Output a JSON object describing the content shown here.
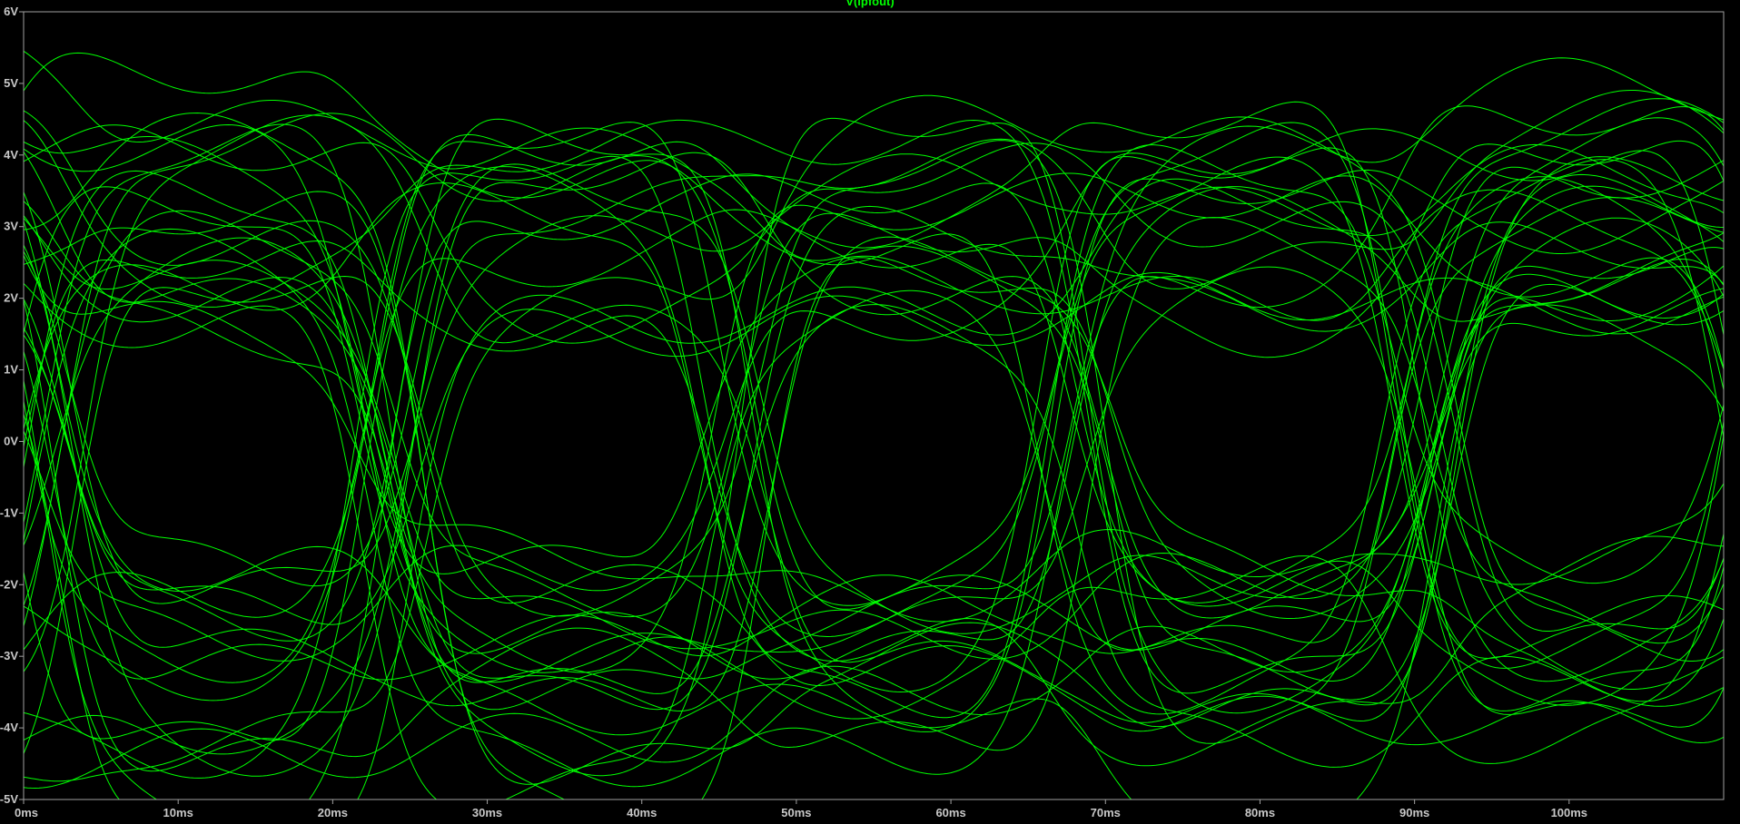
{
  "chart_data": {
    "type": "line",
    "title": "V(lpfout)",
    "xlabel": "",
    "ylabel": "",
    "x_unit": "ms",
    "y_unit": "V",
    "xlim": [
      0,
      110
    ],
    "ylim": [
      -5,
      6
    ],
    "x_ticks": [
      "0ms",
      "10ms",
      "20ms",
      "30ms",
      "40ms",
      "50ms",
      "60ms",
      "70ms",
      "80ms",
      "90ms",
      "100ms"
    ],
    "y_ticks": [
      "6V",
      "5V",
      "4V",
      "3V",
      "2V",
      "1V",
      "0V",
      "-1V",
      "-2V",
      "-3V",
      "-4V",
      "-5V"
    ],
    "grid": false,
    "trace_color": "#00ff00",
    "background": "#000000",
    "description": "Eye diagram: ~45 overlaid sweeps of a low-pass-filtered random bit stream, symbol period ~22ms, transitions crossing near 0V at about 2ms, 23ms, 45ms, 67ms, 89ms; high levels ~2 to 4.5V, low levels ~-2 to -4.5V",
    "series": [
      {
        "name": "V(lpfout)",
        "symbol_period_ms": 22.2,
        "crossing_times_ms": [
          1.5,
          23.5,
          45.5,
          67.5,
          89.5
        ],
        "high_level_range_V": [
          1.0,
          5.0
        ],
        "low_level_range_V": [
          -4.8,
          -1.0
        ]
      }
    ]
  }
}
